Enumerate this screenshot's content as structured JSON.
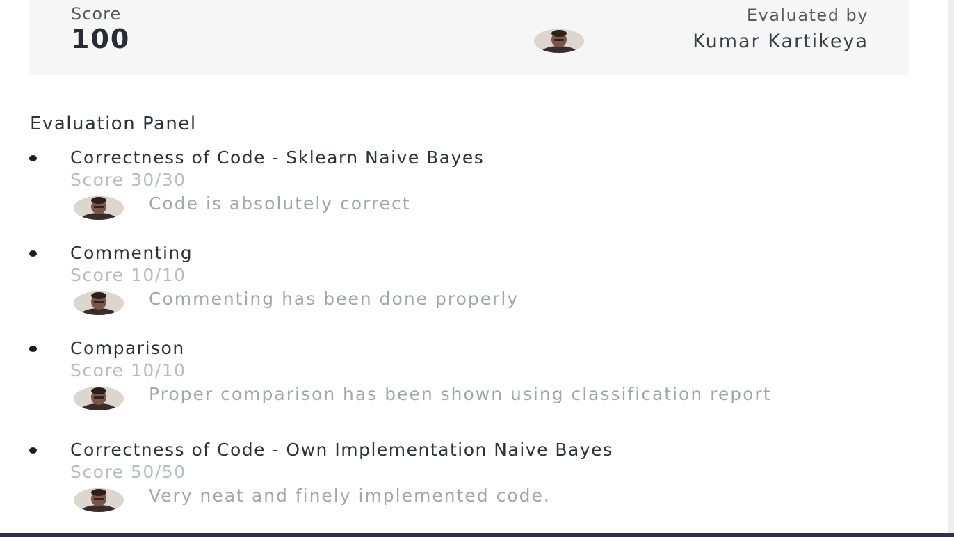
{
  "score": {
    "label": "Score",
    "value": "100"
  },
  "evaluator": {
    "label": "Evaluated by",
    "name": "Kumar Kartikeya"
  },
  "panel": {
    "title": "Evaluation Panel",
    "criteria": [
      {
        "title": "Correctness of Code - Sklearn Naive Bayes",
        "score": "Score 30/30",
        "comment": "Code is absolutely correct"
      },
      {
        "title": "Commenting",
        "score": "Score 10/10",
        "comment": "Commenting has been done properly"
      },
      {
        "title": "Comparison",
        "score": "Score 10/10",
        "comment": "Proper comparison has been shown using classification report"
      },
      {
        "title": "Correctness of Code - Own Implementation Naive Bayes",
        "score": "Score 50/50",
        "comment": "Very neat and finely implemented code."
      }
    ]
  },
  "icons": {
    "avatar": "user-avatar-photo"
  },
  "colors": {
    "card_background": "#f6f6f7",
    "primary_text": "#2f323a",
    "muted_text": "#b9bcc2",
    "bottom_bar": "#2d3047"
  }
}
